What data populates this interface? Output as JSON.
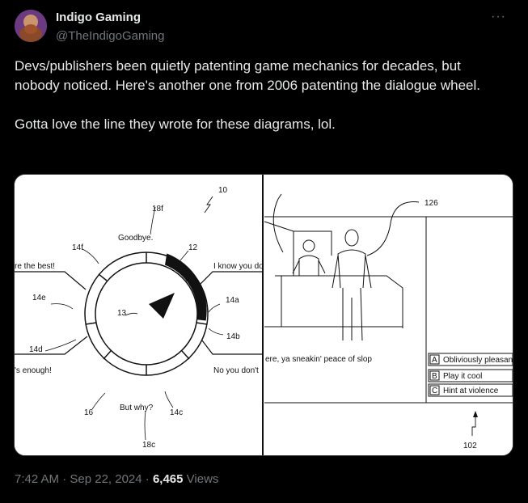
{
  "author": {
    "name": "Indigo Gaming",
    "handle": "@TheIndigoGaming"
  },
  "more_label": "···",
  "tweet_text": "Devs/publishers been quietly patenting game mechanics for decades, but nobody noticed. Here's another one from 2006 patenting the dialogue wheel.\n\nGotta love the line they wrote for these diagrams, lol.",
  "diagram": {
    "wheel": {
      "ref_10": "10",
      "ref_12": "12",
      "ref_13": "13",
      "ref_14a": "14a",
      "ref_14b": "14b",
      "ref_14c": "14c",
      "ref_14d": "14d",
      "ref_14e": "14e",
      "ref_14f": "14f",
      "ref_16": "16",
      "ref_18c": "18c",
      "ref_18f": "18f",
      "opt_top": "Goodbye.",
      "opt_right_top": "I know you do",
      "opt_right_bottom": "No you don't",
      "opt_bottom": "But why?",
      "opt_left_top": "re the best!",
      "opt_left_bottom": "'s enough!"
    },
    "scene": {
      "ref_126": "126",
      "ref_102": "102",
      "subtitle": "ere, ya sneakin' peace of slop",
      "choices": [
        {
          "key": "A",
          "text": "Obliviously pleasant"
        },
        {
          "key": "B",
          "text": "Play it cool"
        },
        {
          "key": "C",
          "text": "Hint at violence"
        }
      ]
    }
  },
  "meta": {
    "time": "7:42 AM · Sep 22, 2024 · ",
    "views": "6,465",
    "views_label": " Views"
  }
}
